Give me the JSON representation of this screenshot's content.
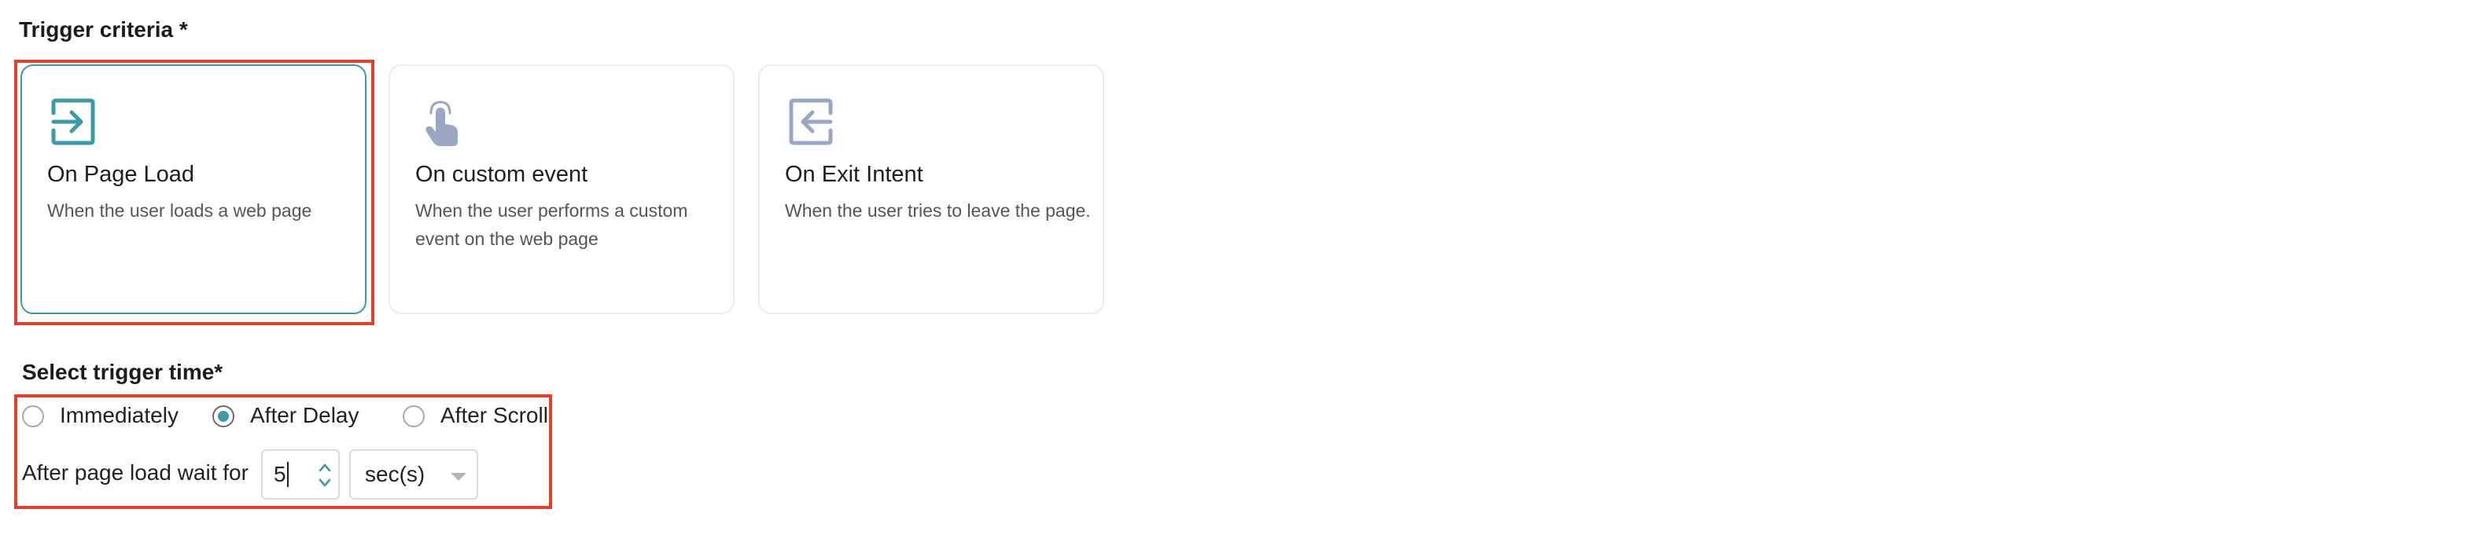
{
  "trigger_criteria": {
    "title": "Trigger criteria *",
    "options": [
      {
        "icon": "enter-icon",
        "title": "On Page Load",
        "description": "When the user loads a web page",
        "selected": true
      },
      {
        "icon": "tap-hand-icon",
        "title": "On custom event",
        "description": "When the user performs a custom event on the web page",
        "selected": false
      },
      {
        "icon": "exit-icon",
        "title": "On Exit Intent",
        "description": "When the user tries to leave the page.",
        "selected": false
      }
    ]
  },
  "trigger_time": {
    "title": "Select trigger time*",
    "options": [
      {
        "label": "Immediately",
        "checked": false
      },
      {
        "label": "After Delay",
        "checked": true
      },
      {
        "label": "After Scroll",
        "checked": false
      }
    ],
    "wait_label": "After page load wait for",
    "delay_value": "5",
    "unit_value": "sec(s)"
  },
  "colors": {
    "accent": "#3d9aa6",
    "highlight": "#e0402a",
    "icon_muted": "#9aa7c4"
  }
}
